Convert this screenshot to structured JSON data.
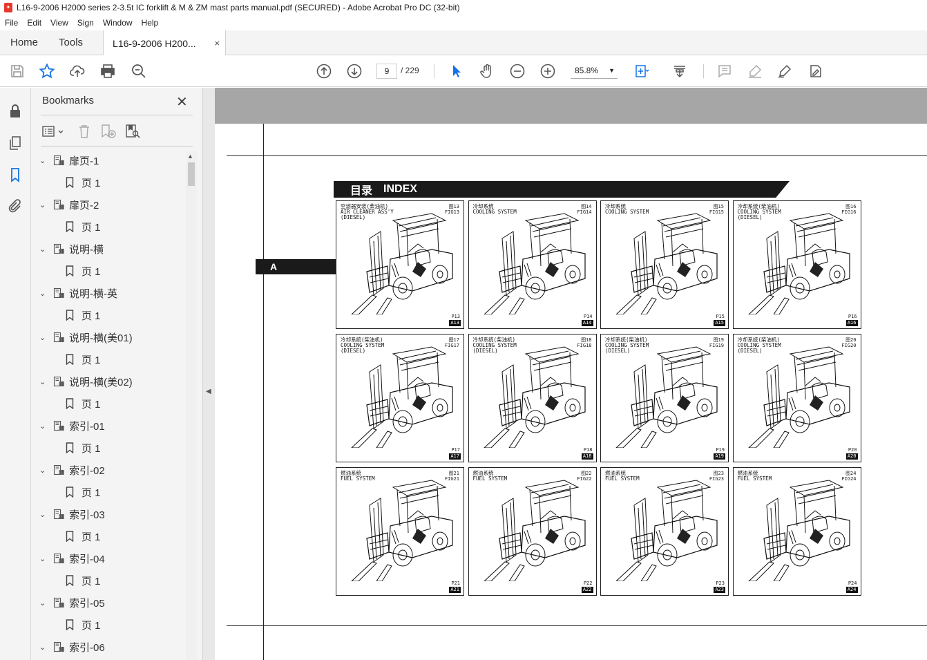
{
  "window": {
    "title": "L16-9-2006 H2000 series 2-3.5t IC forklift & M & ZM mast parts manual.pdf (SECURED) - Adobe Acrobat Pro DC (32-bit)"
  },
  "menu": [
    "File",
    "Edit",
    "View",
    "Sign",
    "Window",
    "Help"
  ],
  "tabs": {
    "home": "Home",
    "tools": "Tools",
    "document": "L16-9-2006 H200...",
    "close": "×"
  },
  "toolbar": {
    "page_current": "9",
    "page_total": "/  229",
    "zoom": "85.8%"
  },
  "bookmarks": {
    "title": "Bookmarks",
    "close": "✕",
    "items": [
      {
        "label": "扉页-1",
        "child": "页 1"
      },
      {
        "label": "扉页-2",
        "child": "页 1"
      },
      {
        "label": "说明-横",
        "child": "页 1"
      },
      {
        "label": "说明-横-英",
        "child": "页 1"
      },
      {
        "label": "说明-横(美01)",
        "child": "页 1"
      },
      {
        "label": "说明-横(美02)",
        "child": "页 1"
      },
      {
        "label": "索引-01",
        "child": "页 1"
      },
      {
        "label": "索引-02",
        "child": "页 1"
      },
      {
        "label": "索引-03",
        "child": "页 1"
      },
      {
        "label": "索引-04",
        "child": "页 1"
      },
      {
        "label": "索引-05",
        "child": "页 1"
      },
      {
        "label": "索引-06",
        "child": ""
      }
    ]
  },
  "document": {
    "index_title_cn": "目录",
    "index_title_en": "INDEX",
    "section_tab": "A",
    "cells": [
      {
        "title": "空滤器安装(柴油机)\nAIR CLEANER ASS'Y\n(DIESEL)",
        "fig": "图13\nFIG13",
        "page": "P13",
        "code": "A13"
      },
      {
        "title": "冷却系统\nCOOLING SYSTEM",
        "fig": "图14\nFIG14",
        "page": "P14",
        "code": "A14"
      },
      {
        "title": "冷却系统\nCOOLING SYSTEM",
        "fig": "图15\nFIG15",
        "page": "P15",
        "code": "A15"
      },
      {
        "title": "冷却系统(柴油机)\nCOOLING SYSTEM\n(DIESEL)",
        "fig": "图16\nFIG16",
        "page": "P16",
        "code": "A16"
      },
      {
        "title": "冷却系统(柴油机)\nCOOLING SYSTEM\n(DIESEL)",
        "fig": "图17\nFIG17",
        "page": "P17",
        "code": "A17"
      },
      {
        "title": "冷却系统(柴油机)\nCOOLING SYSTEM\n(DIESEL)",
        "fig": "图18\nFIG18",
        "page": "P18",
        "code": "A18"
      },
      {
        "title": "冷却系统(柴油机)\nCOOLING SYSTEM\n(DIESEL)",
        "fig": "图19\nFIG19",
        "page": "P19",
        "code": "A19"
      },
      {
        "title": "冷却系统(柴油机)\nCOOLING SYSTEM\n(DIESEL)",
        "fig": "图20\nFIG20",
        "page": "P20",
        "code": "A20"
      },
      {
        "title": "燃油系统\nFUEL SYSTEM",
        "fig": "图21\nFIG21",
        "page": "P21",
        "code": "A21"
      },
      {
        "title": "燃油系统\nFUEL SYSTEM",
        "fig": "图22\nFIG22",
        "page": "P22",
        "code": "A22"
      },
      {
        "title": "燃油系统\nFUEL SYSTEM",
        "fig": "图23\nFIG23",
        "page": "P23",
        "code": "A23"
      },
      {
        "title": "燃油系统\nFUEL SYSTEM",
        "fig": "图24\nFIG24",
        "page": "P24",
        "code": "A24"
      }
    ]
  },
  "icons": {
    "toolbar": [
      "save-icon",
      "bookmark-star-icon",
      "upload-icon",
      "print-icon",
      "find-zoom-icon",
      "prev-page-icon",
      "next-page-icon",
      "select-cursor-icon",
      "hand-tool-icon",
      "zoom-out-icon",
      "zoom-in-icon",
      "fit-page-icon",
      "scroll-mode-icon",
      "comment-icon",
      "highlight-icon",
      "sign-icon",
      "fill-sign-icon"
    ],
    "rail": [
      "lock-icon",
      "pages-icon",
      "bookmark-icon",
      "attachment-icon"
    ]
  },
  "colors": {
    "accent": "#1473e6",
    "doc_header_gray": "#a6a6a6",
    "acrobat_red": "#e6382c"
  }
}
